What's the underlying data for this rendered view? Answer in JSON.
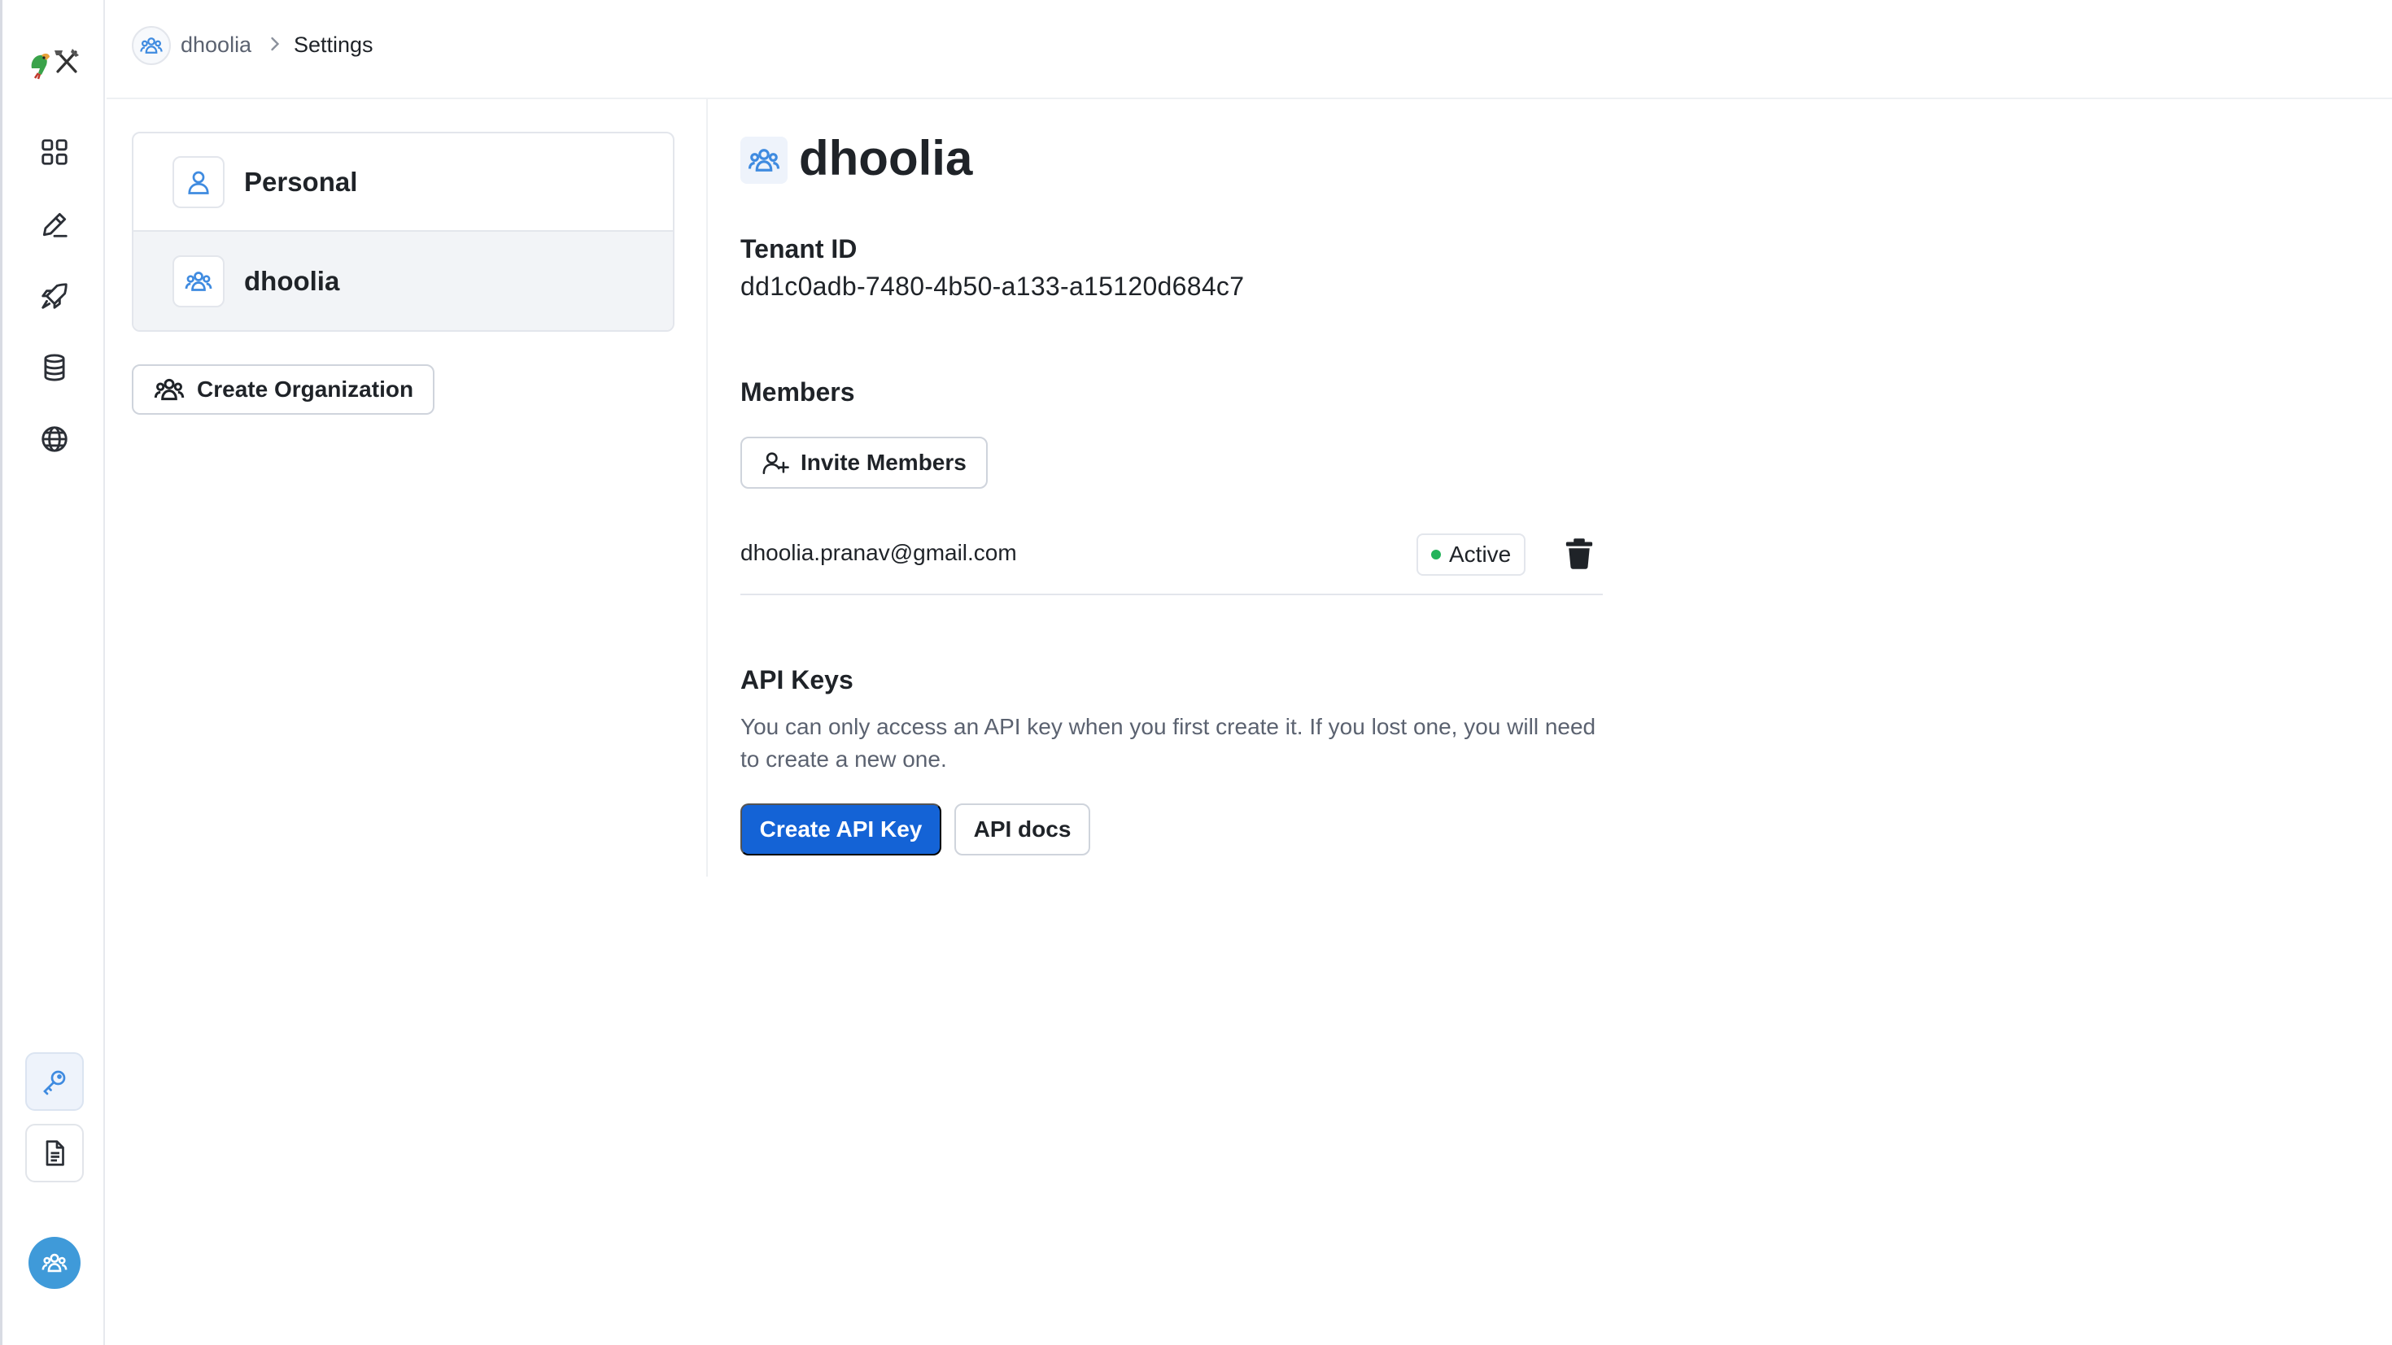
{
  "breadcrumb": {
    "org": "dhoolia",
    "page": "Settings"
  },
  "nav": {
    "icons": [
      "dashboard-icon",
      "edit-icon",
      "rocket-icon",
      "database-icon",
      "globe-icon"
    ],
    "bottom_icons": [
      "key-icon",
      "document-icon"
    ],
    "avatar_icon": "team-icon"
  },
  "org_list": {
    "items": [
      {
        "label": "Personal",
        "icon": "user-icon"
      },
      {
        "label": "dhoolia",
        "icon": "team-icon"
      }
    ],
    "create_label": "Create Organization"
  },
  "main": {
    "title": "dhoolia",
    "tenant_label": "Tenant ID",
    "tenant_id": "dd1c0adb-7480-4b50-a133-a15120d684c7",
    "members_label": "Members",
    "invite_label": "Invite Members",
    "members": [
      {
        "email": "dhoolia.pranav@gmail.com",
        "status": "Active"
      }
    ],
    "api_keys_label": "API Keys",
    "api_keys_desc": "You can only access an API key when you first create it. If you lost one, you will need to create a new one.",
    "create_api_key_label": "Create API Key",
    "api_docs_label": "API docs"
  },
  "colors": {
    "primary": "#1463d6",
    "icon_blue": "#3f8be0",
    "active_dot": "#22b35a",
    "avatar_bg": "#3f9ad9"
  }
}
